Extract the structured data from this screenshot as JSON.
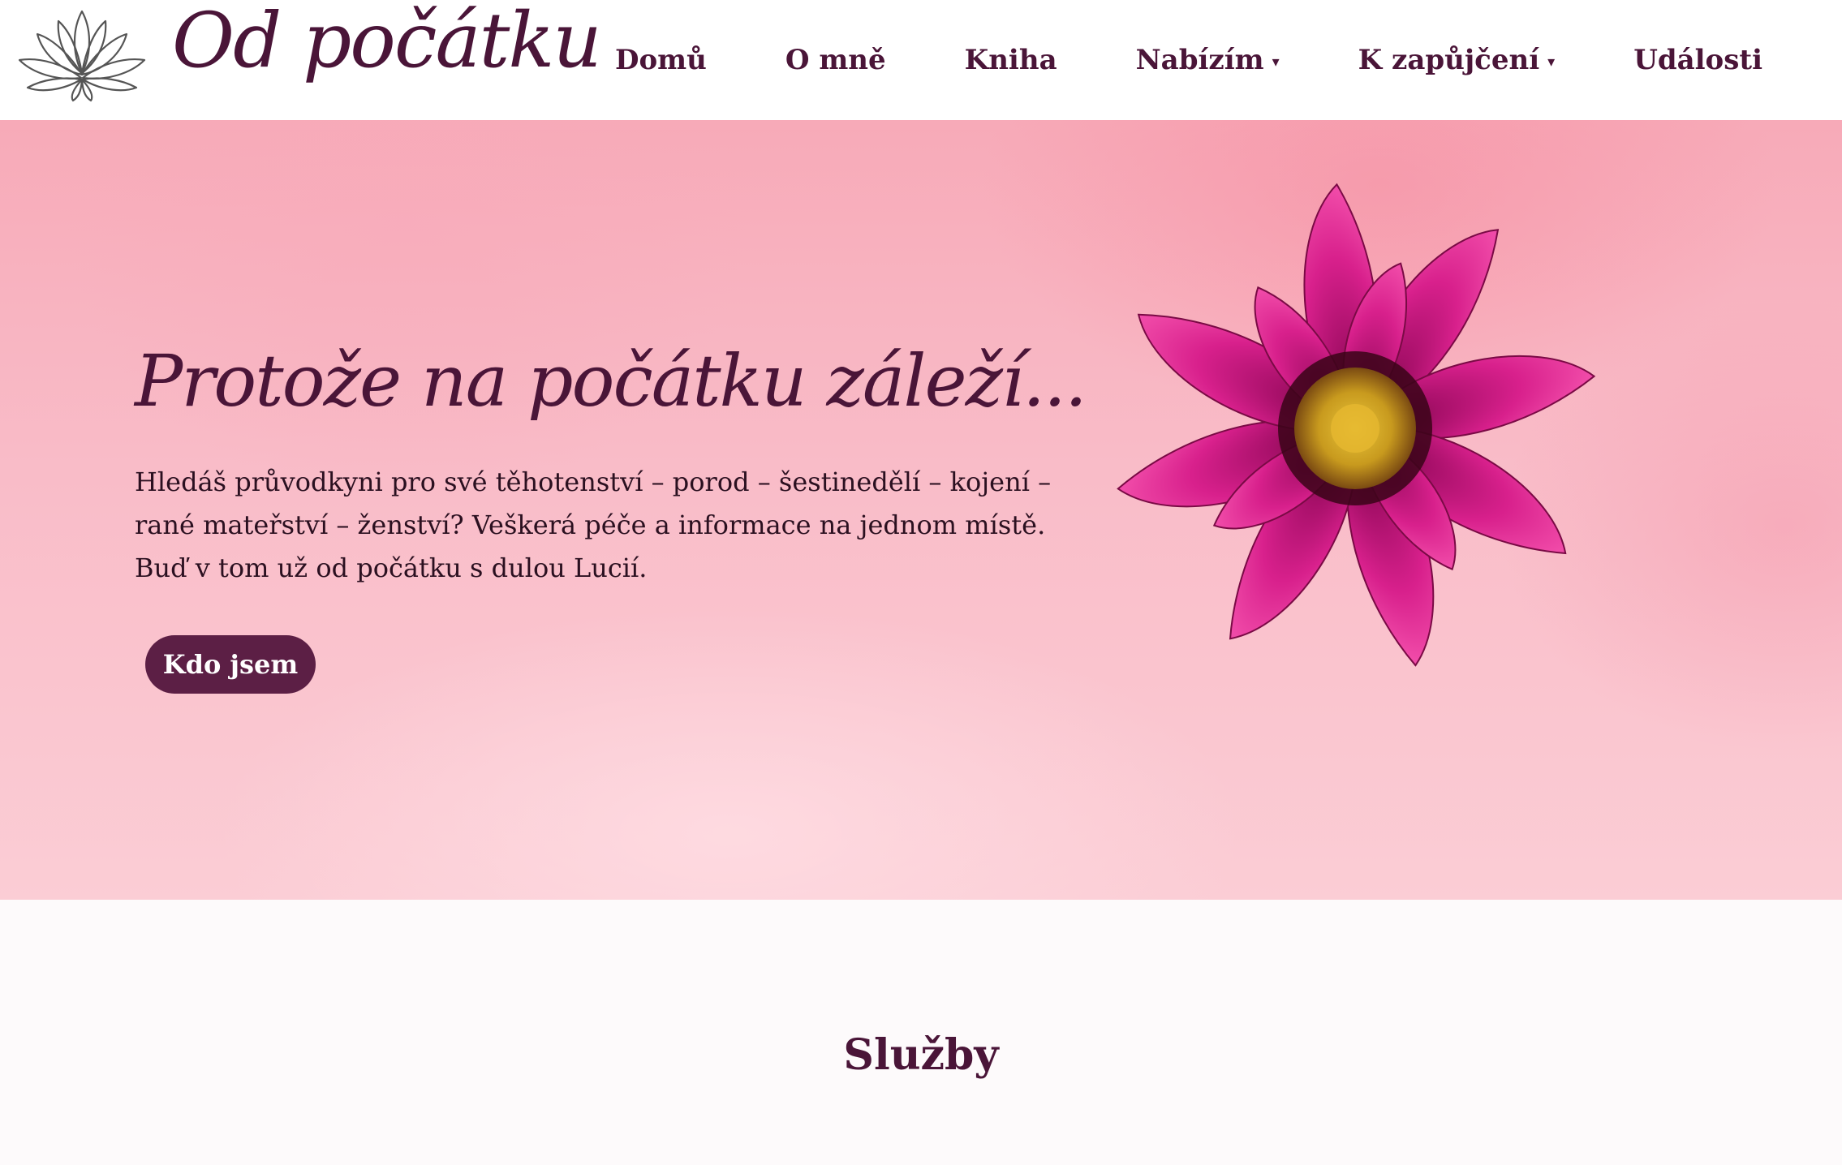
{
  "header": {
    "logo_text": "Od počátku",
    "logo_icon": "lotus-icon"
  },
  "nav": {
    "items": [
      {
        "label": "Domů"
      },
      {
        "label": "O mně"
      },
      {
        "label": "Kniha"
      },
      {
        "label": "Nabízím",
        "dropdown": true
      },
      {
        "label": "K zapůjčení",
        "dropdown": true
      },
      {
        "label": "Události"
      }
    ],
    "dropdown_glyph": "▾"
  },
  "hero": {
    "title": "Protože na počátku záleží...",
    "text": "Hledáš průvodkyni pro své těhotenství – porod – šestinedělí – kojení – rané mateřství – ženství? Veškerá péče a informace na jednom místě. Buď v tom už od počátku s dulou Lucií.",
    "button_label": "Kdo jsem",
    "image": "dahlia-flower"
  },
  "services": {
    "title": "Služby"
  },
  "colors": {
    "brand": "#4a1538",
    "button": "#5c1f45",
    "hero_bg": "#f9bcc8",
    "flower": "#c8157a"
  }
}
